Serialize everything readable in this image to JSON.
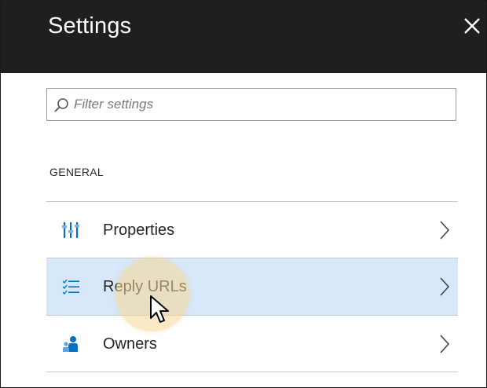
{
  "panel": {
    "title": "Settings",
    "close_icon": "close-icon"
  },
  "filter": {
    "placeholder": "Filter settings",
    "value": "",
    "icon": "search-icon"
  },
  "general": {
    "section_label": "GENERAL",
    "items": [
      {
        "label": "Properties",
        "icon": "properties-icon",
        "selected": false
      },
      {
        "label": "Reply URLs",
        "icon": "reply-urls-icon",
        "selected": true
      },
      {
        "label": "Owners",
        "icon": "owners-icon",
        "selected": false
      }
    ]
  },
  "colors": {
    "header_bg": "#1f1f1f",
    "selected_row_bg": "#d6e8fa",
    "icon_blue": "#0072c6"
  }
}
